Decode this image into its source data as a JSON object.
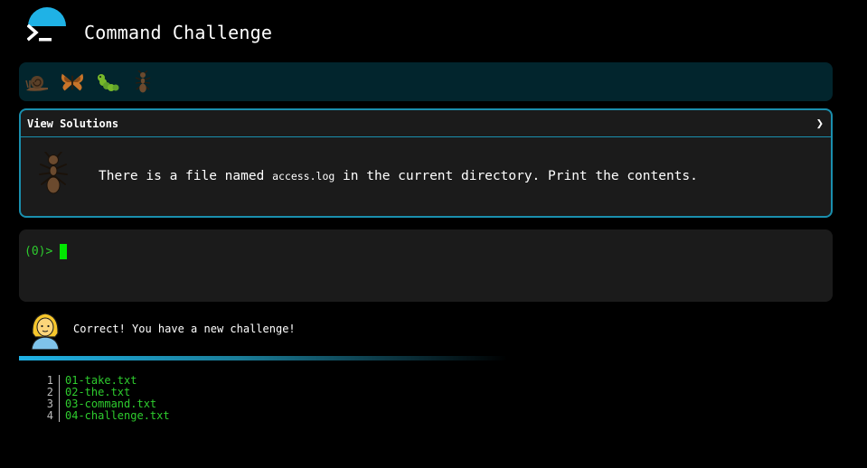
{
  "header": {
    "title": "Command Challenge",
    "logo_icon": "terminal-prompt-icon",
    "accent_color": "#1fb2e6"
  },
  "levels": {
    "items": [
      {
        "icon": "snail-icon"
      },
      {
        "icon": "butterfly-icon"
      },
      {
        "icon": "caterpillar-icon"
      },
      {
        "icon": "ant-icon"
      }
    ]
  },
  "challenge": {
    "solutions_label": "View Solutions",
    "expand_icon": "chevron-right-icon",
    "text_before": "There is a file named ",
    "filename": "access.log",
    "text_after": " in the current directory. Print the contents.",
    "level_icon": "ant-icon"
  },
  "terminal": {
    "prompt": "(0)>",
    "input_value": ""
  },
  "feedback": {
    "avatar_icon": "woman-avatar-icon",
    "message": "Correct! You have a new challenge!"
  },
  "output": {
    "lines": [
      {
        "num": "1",
        "text": "01-take.txt"
      },
      {
        "num": "2",
        "text": "02-the.txt"
      },
      {
        "num": "3",
        "text": "03-command.txt"
      },
      {
        "num": "4",
        "text": "04-challenge.txt"
      }
    ]
  }
}
